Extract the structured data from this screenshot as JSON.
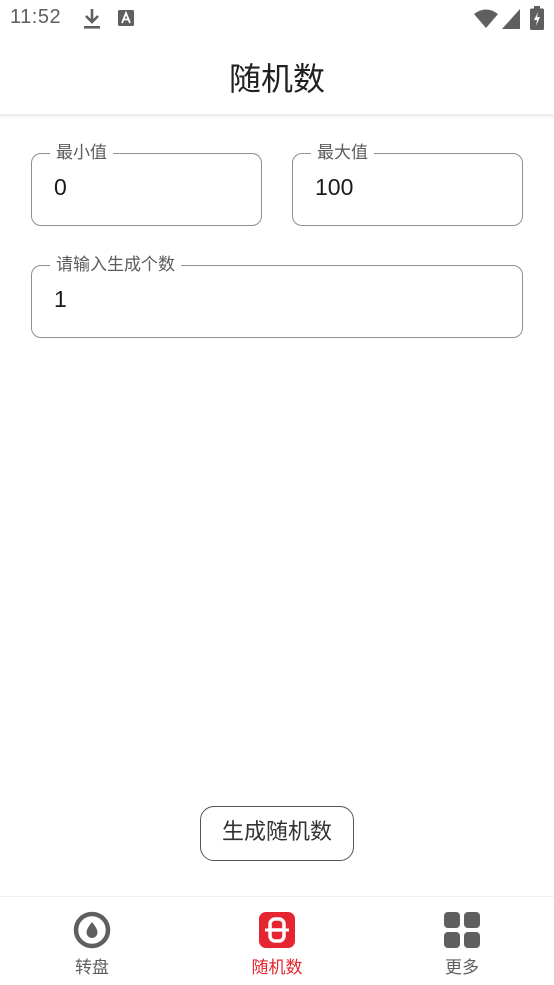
{
  "status_bar": {
    "time": "11:52",
    "icons": [
      "download-icon",
      "font-a-icon",
      "wifi-icon",
      "signal-icon",
      "battery-icon"
    ]
  },
  "app_bar": {
    "title": "随机数"
  },
  "form": {
    "min": {
      "label": "最小值",
      "value": "0"
    },
    "max": {
      "label": "最大值",
      "value": "100"
    },
    "count": {
      "label": "请输入生成个数",
      "value": "1"
    }
  },
  "generate_button": {
    "label": "生成随机数"
  },
  "bottom_nav": {
    "items": [
      {
        "label": "转盘",
        "icon": "wheel-icon",
        "active": false
      },
      {
        "label": "随机数",
        "icon": "dice-icon",
        "active": true
      },
      {
        "label": "更多",
        "icon": "grid-icon",
        "active": false
      }
    ]
  },
  "colors": {
    "accent": "#e5252f",
    "icon_gray": "#5f5f5f",
    "outline": "#8f8f8f"
  }
}
